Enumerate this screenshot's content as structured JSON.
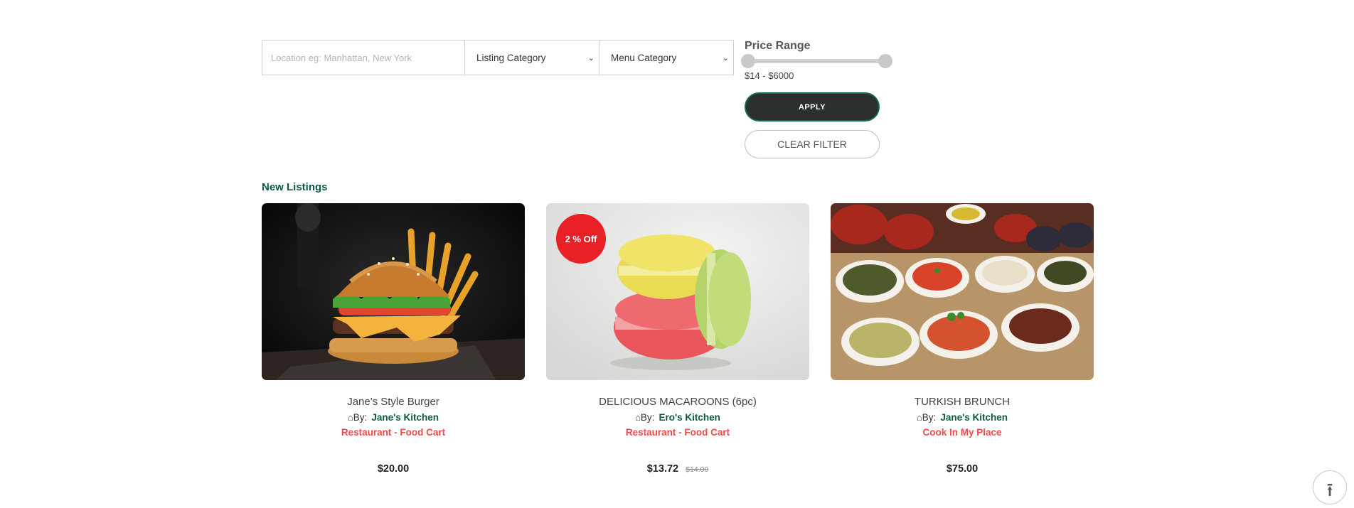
{
  "filters": {
    "location_placeholder": "Location eg: Manhattan, New York",
    "location_value": "",
    "listing_category": "Listing Category",
    "menu_category": "Menu Category",
    "price_range_title": "Price Range",
    "price_range_value": "$14 - $6000",
    "price_min_fraction": 0.0,
    "price_max_fraction": 1.0,
    "apply_label": "APPLY",
    "clear_label": "CLEAR FILTER"
  },
  "section_title": "New Listings",
  "listings": [
    {
      "title": "Jane's Style Burger",
      "by_label": "By:",
      "kitchen": "Jane's Kitchen",
      "category": "Restaurant - Food Cart",
      "price": "$20.00",
      "old_price": "",
      "discount": ""
    },
    {
      "title": "DELICIOUS MACAROONS (6pc)",
      "by_label": "By:",
      "kitchen": "Ero's Kitchen",
      "category": "Restaurant - Food Cart",
      "price": "$13.72",
      "old_price": "$14.00",
      "discount": "2 % Off"
    },
    {
      "title": "TURKISH BRUNCH",
      "by_label": "By:",
      "kitchen": "Jane's Kitchen",
      "category": "Cook In My Place",
      "price": "$75.00",
      "old_price": "",
      "discount": ""
    }
  ],
  "icons": {
    "home": "home-icon",
    "select_chevron": "chevron-down-icon",
    "scroll_top": "arrow-up-icon"
  },
  "colors": {
    "brand_green": "#0c5a43",
    "category_red": "#f04a4a",
    "badge_red": "#ea2027",
    "apply_bg": "#2b2f2f"
  }
}
